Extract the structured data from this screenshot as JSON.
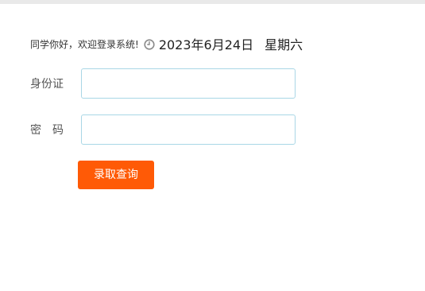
{
  "header": {
    "greeting": "同学你好，欢迎登录系统!",
    "clock_icon": "clock-icon",
    "date": "2023年6月24日",
    "weekday": "星期六"
  },
  "form": {
    "id_label": "身份证",
    "id_value": "",
    "password_label": "密码",
    "password_value": "",
    "submit_label": "录取查询"
  },
  "colors": {
    "accent": "#ff5a06",
    "input_border": "#a9d7e6",
    "top_bar": "#e9e9e9"
  }
}
